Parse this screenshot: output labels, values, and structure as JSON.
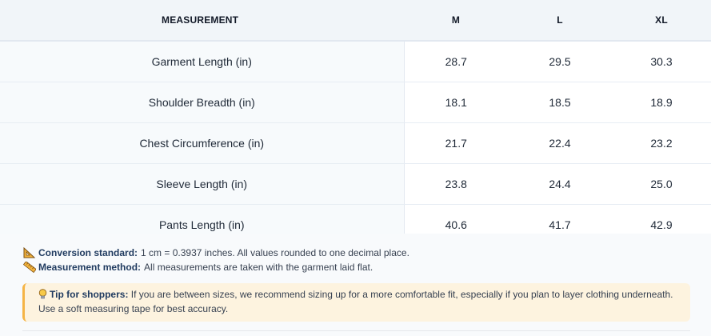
{
  "table": {
    "headers": [
      "MEASUREMENT",
      "M",
      "L",
      "XL"
    ],
    "rows": [
      {
        "label": "Garment Length (in)",
        "m": "28.7",
        "l": "29.5",
        "xl": "30.3"
      },
      {
        "label": "Shoulder Breadth (in)",
        "m": "18.1",
        "l": "18.5",
        "xl": "18.9"
      },
      {
        "label": "Chest Circumference (in)",
        "m": "21.7",
        "l": "22.4",
        "xl": "23.2"
      },
      {
        "label": "Sleeve Length (in)",
        "m": "23.8",
        "l": "24.4",
        "xl": "25.0"
      },
      {
        "label": "Pants Length (in)",
        "m": "40.6",
        "l": "41.7",
        "xl": "42.9"
      }
    ]
  },
  "notes": {
    "conversion_label": "Conversion standard:",
    "conversion_text": "1 cm = 0.3937 inches. All values rounded to one decimal place.",
    "method_label": "Measurement method:",
    "method_text": "All measurements are taken with the garment laid flat."
  },
  "tip": {
    "label": "Tip for shoppers:",
    "text": "If you are between sizes, we recommend sizing up for a more comfortable fit, especially if you plan to layer clothing underneath. Use a soft measuring tape for best accuracy."
  },
  "icons": {
    "conversion": "triangle-ruler-icon",
    "method": "ruler-icon",
    "tip": "lightbulb-icon"
  },
  "colors": {
    "tip_accent": "#f5b445",
    "tip_bg": "#fdf3df",
    "label_color": "#1f3a5f"
  }
}
